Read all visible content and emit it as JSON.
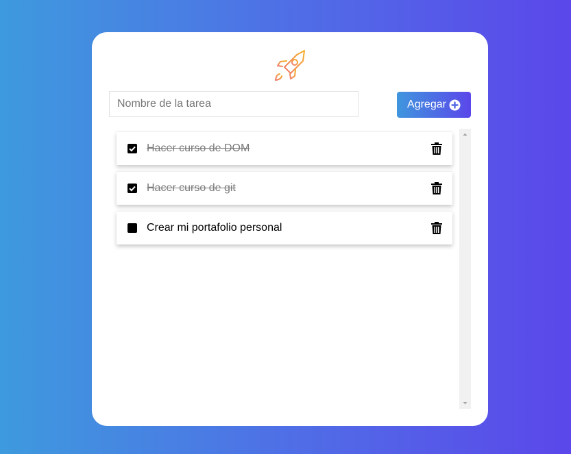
{
  "form": {
    "input_placeholder": "Nombre de la tarea",
    "input_value": "",
    "add_label": "Agregar"
  },
  "logo": {
    "icon": "rocket-icon",
    "colors": [
      "#f6a623",
      "#ef7b6e"
    ]
  },
  "tasks": [
    {
      "text": "Hacer curso de DOM",
      "completed": true
    },
    {
      "text": "Hacer curso de git",
      "completed": true
    },
    {
      "text": "Crear mi portafolio personal",
      "completed": false
    }
  ],
  "colors": {
    "background_start": "#3e9ade",
    "background_end": "#5b47ea",
    "card": "#ffffff",
    "button_start": "#3f96de",
    "button_end": "#5b47ea"
  }
}
